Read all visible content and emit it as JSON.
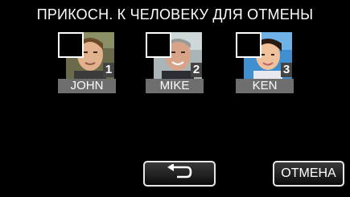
{
  "screen": {
    "title": "ПРИКОСН. К ЧЕЛОВЕКУ ДЛЯ ОТМЕНЫ"
  },
  "faces": [
    {
      "name": "JOHN",
      "number": "1",
      "checked": false
    },
    {
      "name": "MIKE",
      "number": "2",
      "checked": false
    },
    {
      "name": "KEN",
      "number": "3",
      "checked": false
    }
  ],
  "buttons": {
    "back_icon": "return-arrow-icon",
    "cancel_label": "ОТМЕНА"
  }
}
